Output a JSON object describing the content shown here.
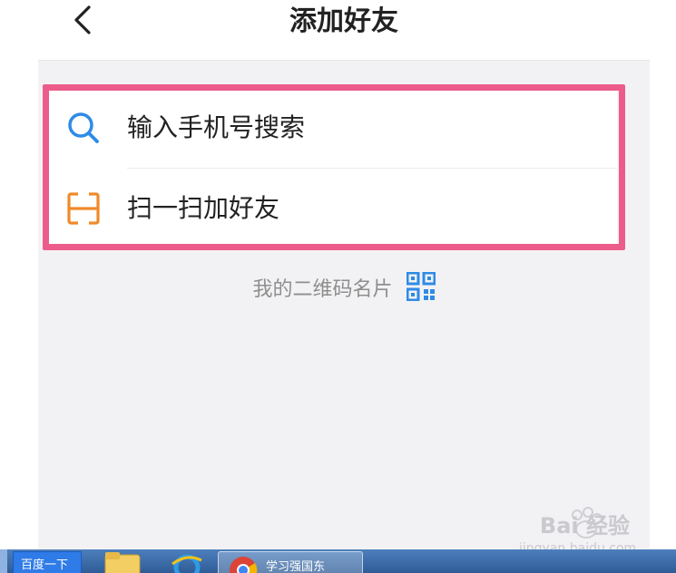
{
  "header": {
    "title": "添加好友",
    "back_icon": "chevron-left-icon"
  },
  "menu": {
    "items": [
      {
        "label": "输入手机号搜索",
        "icon": "search-icon",
        "icon_color": "#2e8be6"
      },
      {
        "label": "扫一扫加好友",
        "icon": "scan-icon",
        "icon_color": "#f08a2a"
      }
    ]
  },
  "qr_card": {
    "label": "我的二维码名片",
    "icon": "qr-code-icon",
    "icon_color": "#2e8be6"
  },
  "highlight_color": "#ec5c8a",
  "watermark": {
    "logo": "Bai  经验",
    "url": "jingyan.baidu.com"
  },
  "taskbar": {
    "baidu_button": "百度一下",
    "chrome_window_label": "学习强国东"
  }
}
